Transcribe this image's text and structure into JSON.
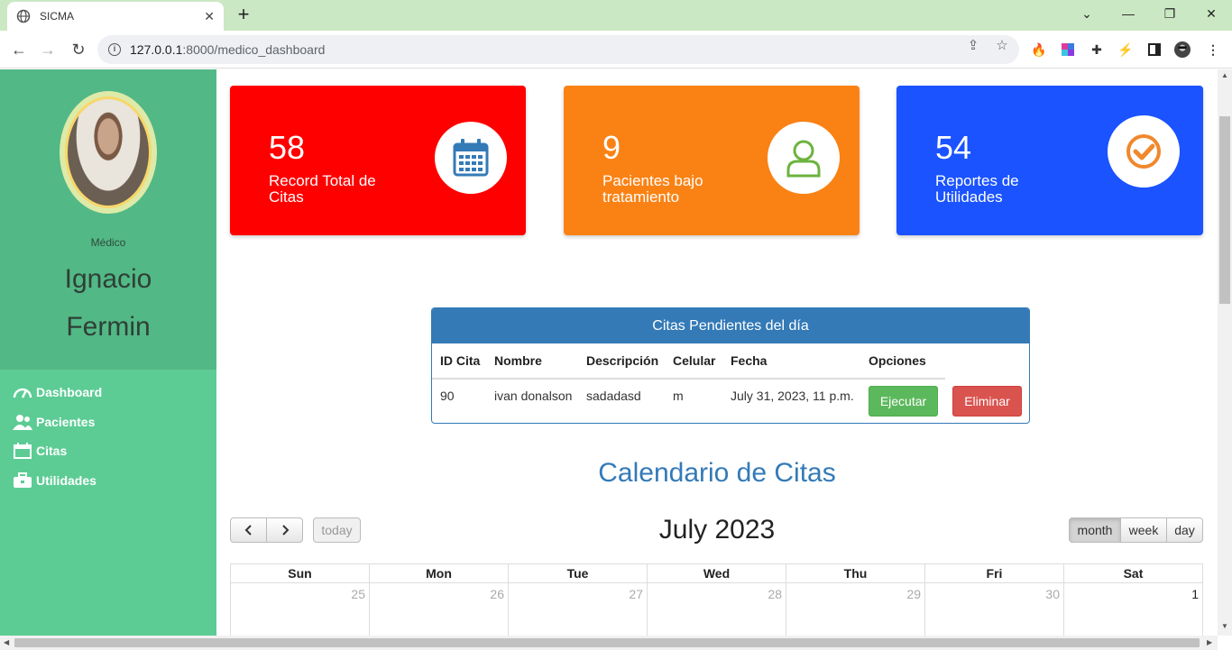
{
  "browser": {
    "tab_title": "SICMA",
    "url_host": "127.0.0.1",
    "url_path": ":8000/medico_dashboard"
  },
  "sidebar": {
    "role": "Médico",
    "first_name": "Ignacio",
    "last_name": "Fermin",
    "menu": [
      {
        "label": "Dashboard",
        "icon": "gauge-icon"
      },
      {
        "label": "Pacientes",
        "icon": "users-icon"
      },
      {
        "label": "Citas",
        "icon": "calendar-icon"
      },
      {
        "label": "Utilidades",
        "icon": "briefcase-icon"
      }
    ]
  },
  "cards": [
    {
      "value": "58",
      "label": "Record Total de Citas",
      "color": "#ff0000",
      "icon": "calendar-icon",
      "icon_color": "#337ab7"
    },
    {
      "value": "9",
      "label": "Pacientes bajo tratamiento",
      "color": "#fa8214",
      "icon": "user-icon",
      "icon_color": "#6cb33e"
    },
    {
      "value": "54",
      "label": "Reportes de Utilidades",
      "color": "#1a53ff",
      "icon": "check-circle-icon",
      "icon_color": "#f0882c"
    }
  ],
  "appointments": {
    "title": "Citas Pendientes del día",
    "headers": [
      "ID Cita",
      "Nombre",
      "Descripción",
      "Celular",
      "Fecha",
      "Opciones"
    ],
    "rows": [
      {
        "id": "90",
        "nombre": "ivan donalson",
        "descripcion": "sadadasd",
        "celular": "m",
        "fecha": "July 31, 2023, 11 p.m.",
        "execute_label": "Ejecutar",
        "delete_label": "Eliminar"
      }
    ]
  },
  "calendar": {
    "heading": "Calendario de Citas",
    "month_title": "July 2023",
    "today_label": "today",
    "views": [
      "month",
      "week",
      "day"
    ],
    "active_view": "month",
    "day_names": [
      "Sun",
      "Mon",
      "Tue",
      "Wed",
      "Thu",
      "Fri",
      "Sat"
    ],
    "first_row": [
      "25",
      "26",
      "27",
      "28",
      "29",
      "30",
      "1"
    ]
  }
}
